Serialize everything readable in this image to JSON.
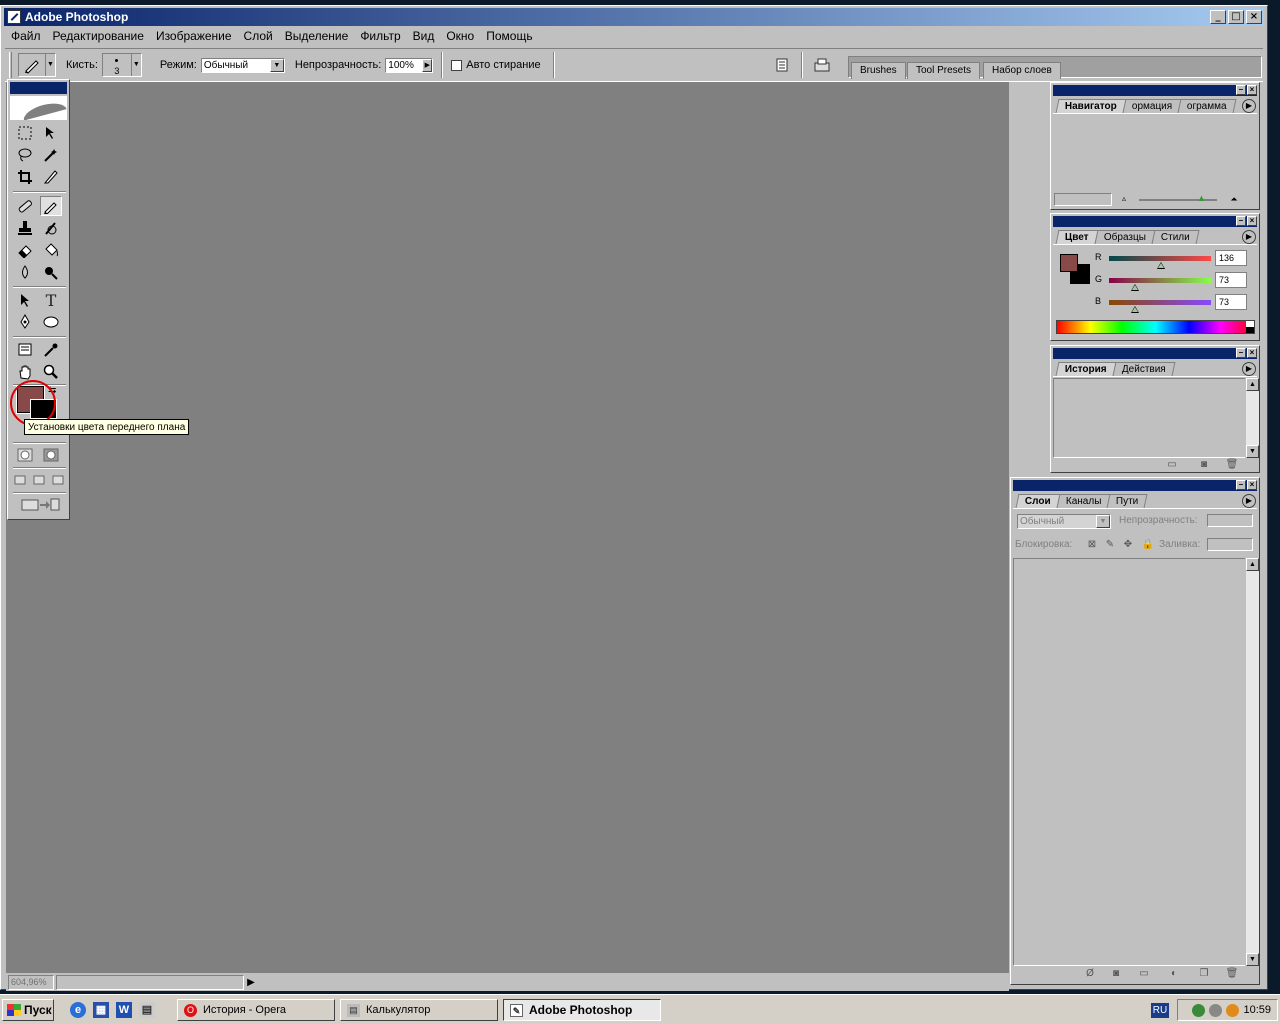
{
  "window": {
    "title": "Adobe Photoshop",
    "controls": [
      "minimize",
      "maximize",
      "close"
    ]
  },
  "menu": [
    "Файл",
    "Редактирование",
    "Изображение",
    "Слой",
    "Выделение",
    "Фильтр",
    "Вид",
    "Окно",
    "Помощь"
  ],
  "options": {
    "brush_label": "Кисть:",
    "brush_size": "3",
    "mode_label": "Режим:",
    "mode_value": "Обычный",
    "opacity_label": "Непрозрачность:",
    "opacity_value": "100%",
    "auto_erase_label": "Авто стирание",
    "auto_erase_checked": false
  },
  "palette_well": {
    "tabs": [
      "Brushes",
      "Tool Presets",
      "Набор слоев"
    ]
  },
  "toolbox": {
    "tools": [
      "rectangular-marquee",
      "move",
      "lasso",
      "magic-wand",
      "crop",
      "slice",
      "healing-brush",
      "pencil",
      "clone-stamp",
      "history-brush",
      "eraser",
      "paint-bucket",
      "blur",
      "dodge",
      "path-selection",
      "type",
      "pen",
      "ellipse",
      "notes",
      "eyedropper",
      "hand",
      "zoom"
    ],
    "type_tool_glyph": "T",
    "active_tool": "pencil",
    "foreground_color": "#884949",
    "background_color": "#000000"
  },
  "tooltip": "Установки цвета переднего плана",
  "status": {
    "zoom": "604,96%"
  },
  "navigator_panel": {
    "tabs": [
      "Навигатор",
      "ормация",
      "ограмма"
    ],
    "active_tab": "Навигатор"
  },
  "color_panel": {
    "tabs": [
      "Цвет",
      "Образцы",
      "Стили"
    ],
    "active_tab": "Цвет",
    "channels": [
      {
        "label": "R",
        "value": "136"
      },
      {
        "label": "G",
        "value": "73"
      },
      {
        "label": "B",
        "value": "73"
      }
    ],
    "fg": "#884949"
  },
  "history_panel": {
    "tabs": [
      "История",
      "Действия"
    ],
    "active_tab": "История"
  },
  "layers_panel": {
    "tabs": [
      "Слои",
      "Каналы",
      "Пути"
    ],
    "active_tab": "Слои",
    "blend_mode": "Обычный",
    "opacity_label": "Непрозрачность:",
    "lock_label": "Блокировка:",
    "fill_label": "Заливка:"
  },
  "taskbar": {
    "start_label": "Пуск",
    "tasks": [
      {
        "label": "История - Opera",
        "active": false
      },
      {
        "label": "Калькулятор",
        "active": false
      },
      {
        "label": "Adobe Photoshop",
        "active": true
      }
    ],
    "language": "RU",
    "clock": "10:59"
  }
}
